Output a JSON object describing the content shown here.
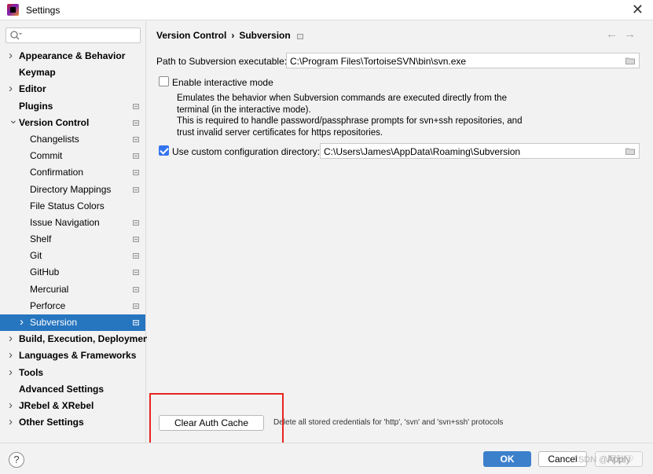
{
  "window": {
    "title": "Settings"
  },
  "search": {
    "value": "",
    "placeholder": ""
  },
  "sidebar": {
    "items": [
      {
        "label": "Appearance & Behavior",
        "bold": true,
        "chevron": true,
        "child": false,
        "proj": false
      },
      {
        "label": "Keymap",
        "bold": true,
        "chevron": false,
        "child": false,
        "proj": false
      },
      {
        "label": "Editor",
        "bold": true,
        "chevron": true,
        "child": false,
        "proj": false
      },
      {
        "label": "Plugins",
        "bold": true,
        "chevron": false,
        "child": false,
        "proj": true
      },
      {
        "label": "Version Control",
        "bold": true,
        "chevron": "open",
        "child": false,
        "proj": true
      },
      {
        "label": "Changelists",
        "bold": false,
        "chevron": false,
        "child": true,
        "proj": true
      },
      {
        "label": "Commit",
        "bold": false,
        "chevron": false,
        "child": true,
        "proj": true
      },
      {
        "label": "Confirmation",
        "bold": false,
        "chevron": false,
        "child": true,
        "proj": true
      },
      {
        "label": "Directory Mappings",
        "bold": false,
        "chevron": false,
        "child": true,
        "proj": true
      },
      {
        "label": "File Status Colors",
        "bold": false,
        "chevron": false,
        "child": true,
        "proj": false
      },
      {
        "label": "Issue Navigation",
        "bold": false,
        "chevron": false,
        "child": true,
        "proj": true
      },
      {
        "label": "Shelf",
        "bold": false,
        "chevron": false,
        "child": true,
        "proj": true
      },
      {
        "label": "Git",
        "bold": false,
        "chevron": false,
        "child": true,
        "proj": true
      },
      {
        "label": "GitHub",
        "bold": false,
        "chevron": false,
        "child": true,
        "proj": true
      },
      {
        "label": "Mercurial",
        "bold": false,
        "chevron": false,
        "child": true,
        "proj": true
      },
      {
        "label": "Perforce",
        "bold": false,
        "chevron": false,
        "child": true,
        "proj": true
      },
      {
        "label": "Subversion",
        "bold": false,
        "chevron": true,
        "child": true,
        "proj": true,
        "selected": true
      },
      {
        "label": "Build, Execution, Deployment",
        "bold": true,
        "chevron": true,
        "child": false,
        "proj": false
      },
      {
        "label": "Languages & Frameworks",
        "bold": true,
        "chevron": true,
        "child": false,
        "proj": false
      },
      {
        "label": "Tools",
        "bold": true,
        "chevron": true,
        "child": false,
        "proj": false
      },
      {
        "label": "Advanced Settings",
        "bold": true,
        "chevron": false,
        "child": false,
        "proj": false
      },
      {
        "label": "JRebel & XRebel",
        "bold": true,
        "chevron": true,
        "child": false,
        "proj": false
      },
      {
        "label": "Other Settings",
        "bold": true,
        "chevron": true,
        "child": false,
        "proj": false
      }
    ]
  },
  "breadcrumb": {
    "parent": "Version Control",
    "separator": "›",
    "current": "Subversion"
  },
  "nav": {
    "back": "←",
    "forward": "→"
  },
  "svn_path": {
    "label": "Path to Subversion executable:",
    "value": "C:\\Program Files\\TortoiseSVN\\bin\\svn.exe"
  },
  "interactive_mode": {
    "label": "Enable interactive mode",
    "checked": false,
    "desc_lines": [
      "Emulates the behavior when Subversion commands are executed directly from the",
      "terminal (in the interactive mode).",
      "This is required to handle password/passphrase prompts for svn+ssh repositories, and",
      "trust invalid server certificates for https repositories."
    ]
  },
  "custom_config": {
    "label": "Use custom configuration directory:",
    "checked": true,
    "value": "C:\\Users\\James\\AppData\\Roaming\\Subversion"
  },
  "auth_cache": {
    "button_label": "Clear Auth Cache",
    "description": "Delete all stored credentials for 'http', 'svn' and 'svn+ssh' protocols"
  },
  "footer": {
    "help": "?",
    "ok": "OK",
    "cancel": "Cancel",
    "apply": "Apply"
  },
  "watermark": "CSDN @阿秋♡",
  "colors": {
    "selection": "#2675bf",
    "primary_button": "#3c80cc",
    "highlight": "#e8241f",
    "checkbox": "#3574f0"
  }
}
